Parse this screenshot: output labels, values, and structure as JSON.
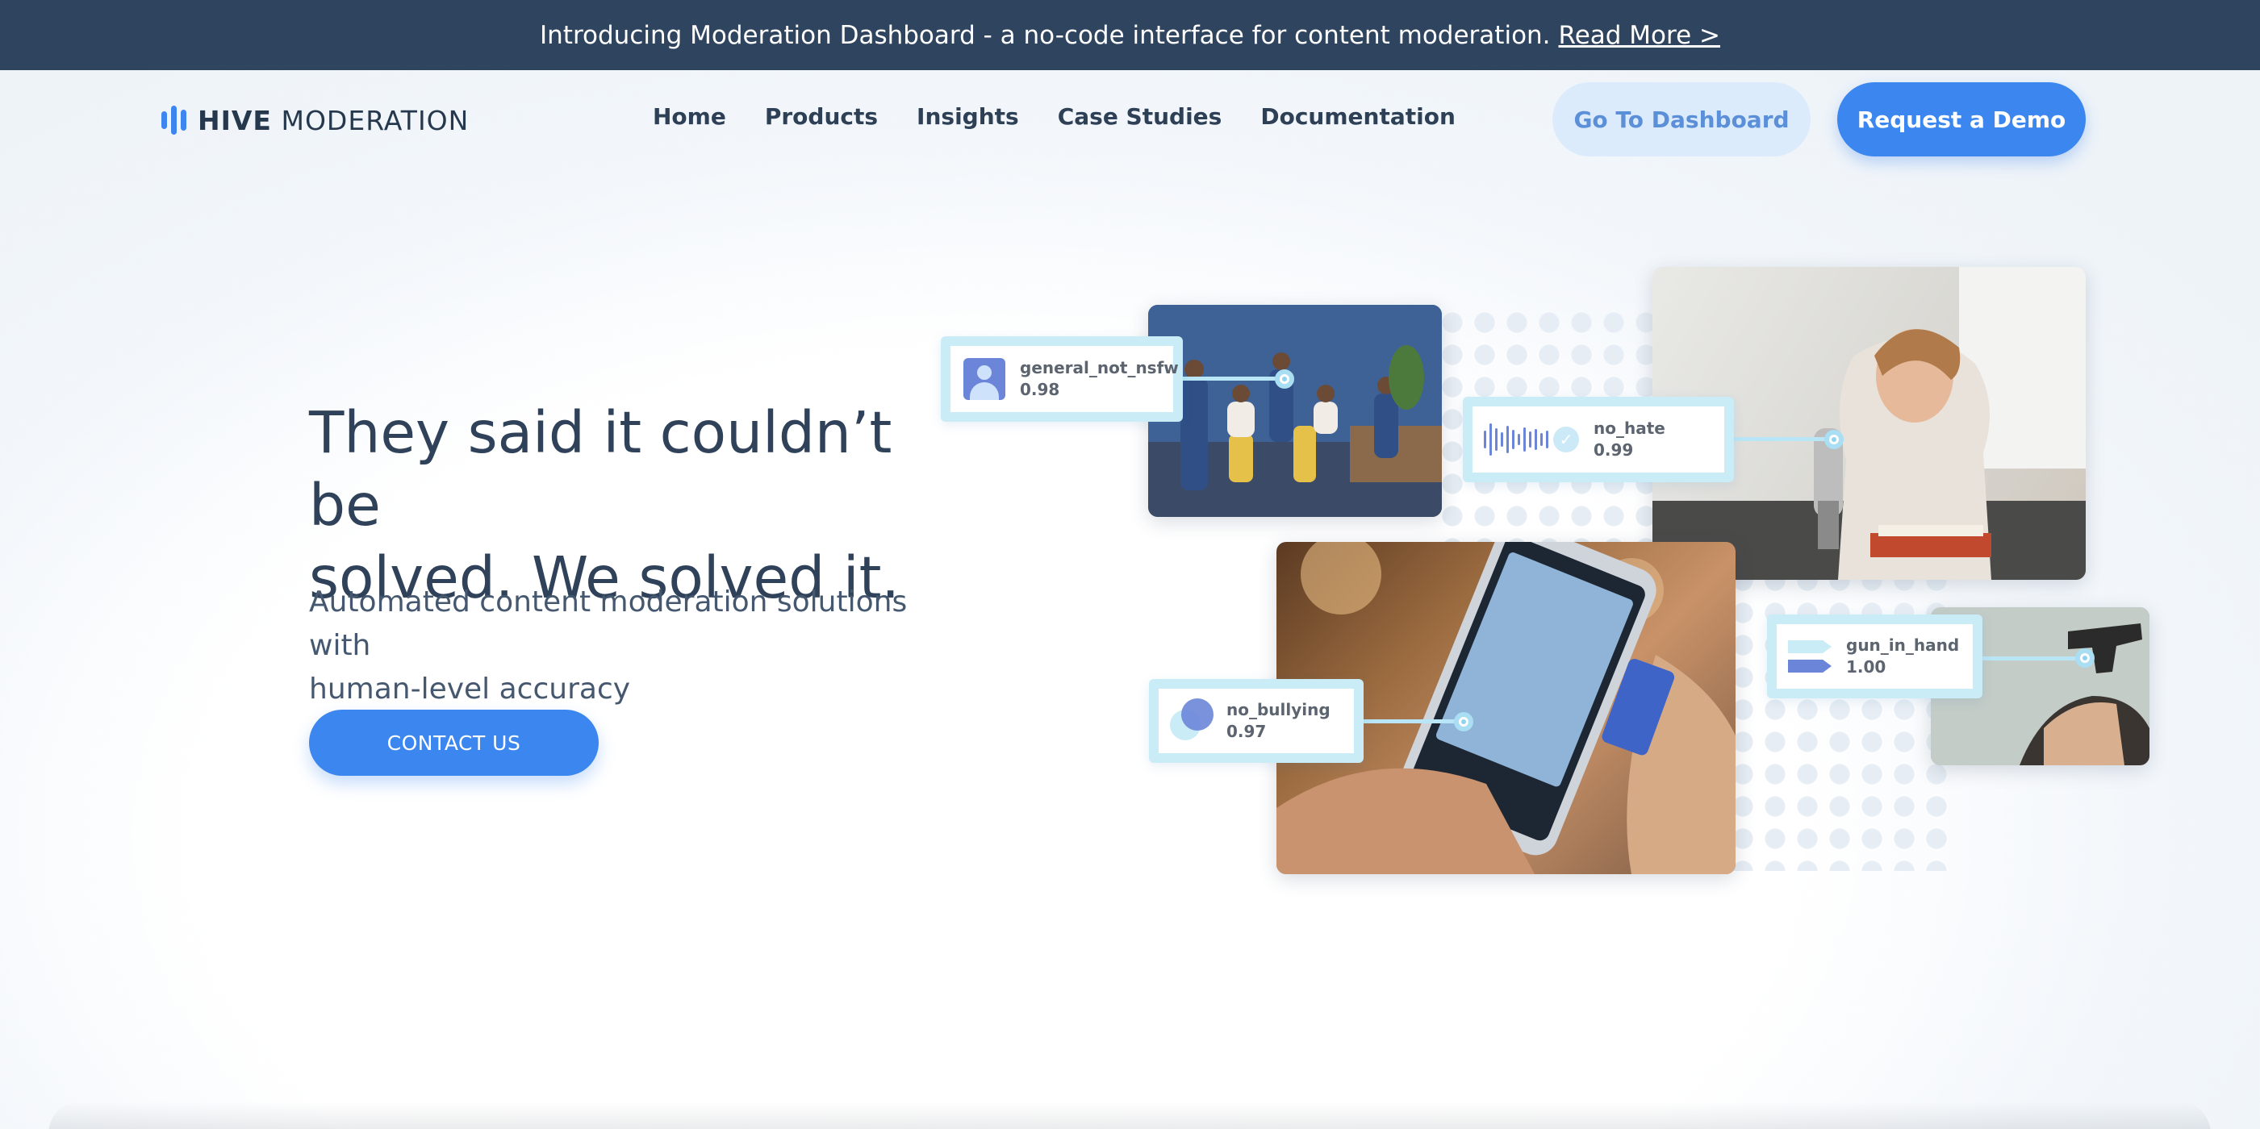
{
  "announcement": {
    "text": "Introducing Moderation Dashboard - a no-code interface for content moderation.",
    "link": "Read More >"
  },
  "logo": {
    "bold": "HIVE",
    "rest": "MODERATION"
  },
  "nav": {
    "items": [
      "Home",
      "Products",
      "Insights",
      "Case Studies",
      "Documentation"
    ]
  },
  "header_buttons": {
    "dashboard": "Go To Dashboard",
    "demo": "Request a Demo"
  },
  "hero": {
    "title_line1": "They said it couldn’t be",
    "title_line2": "solved. We solved it.",
    "subtitle_line1": "Automated content moderation solutions with",
    "subtitle_line2": "human-level accuracy",
    "cta": "CONTACT US"
  },
  "labels": {
    "nsfw": {
      "name": "general_not_nsfw",
      "score": "0.98"
    },
    "hate": {
      "name": "no_hate",
      "score": "0.99"
    },
    "bully": {
      "name": "no_bullying",
      "score": "0.97"
    },
    "gun": {
      "name": "gun_in_hand",
      "score": "1.00"
    }
  },
  "colors": {
    "announce_bg": "#2f455f",
    "accent": "#3b86ef",
    "accent_light": "#dcebfc",
    "label_border": "#c9ecf7"
  },
  "icons": {
    "logo": "bars-icon",
    "nsfw": "user-avatar-icon",
    "hate": "audio-waveform-icon",
    "bully": "overlapping-circles-icon",
    "gun": "tag-flags-icon"
  }
}
